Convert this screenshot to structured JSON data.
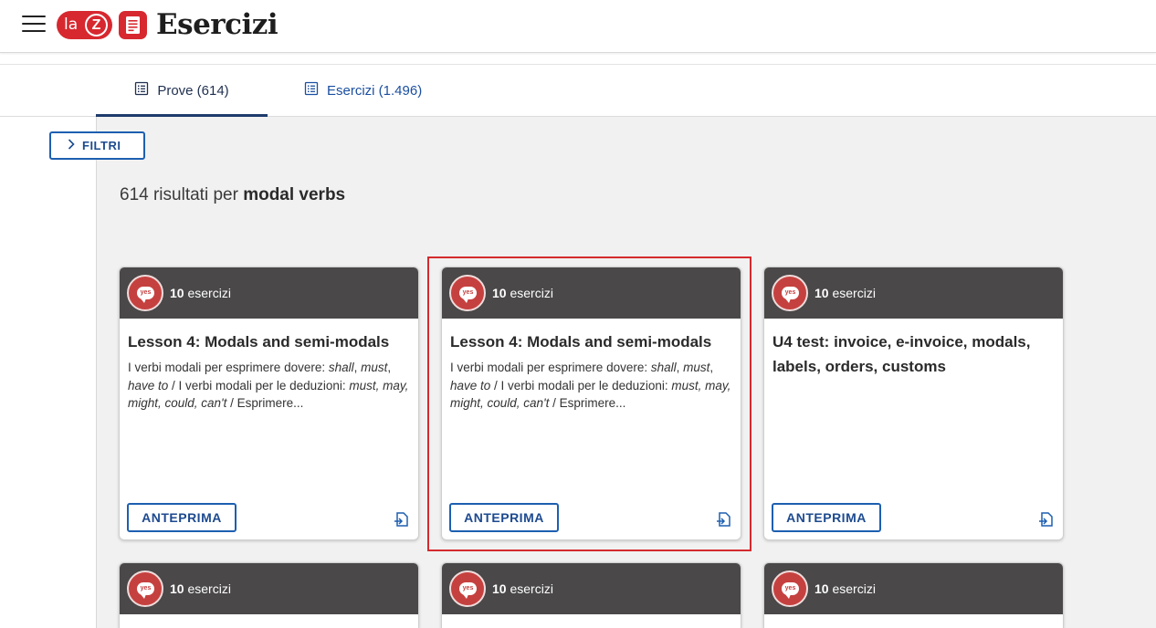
{
  "header": {
    "app_title": "Esercizi",
    "logo_la": "la",
    "logo_z": "Z"
  },
  "tabs": [
    {
      "label": "Prove (614)",
      "active": true
    },
    {
      "label": "Esercizi (1.496)",
      "active": false
    }
  ],
  "filters": {
    "label": "FILTRI"
  },
  "results": {
    "prefix": "614 risultati per",
    "query": "modal verbs"
  },
  "badge_text": "yes",
  "cards": [
    {
      "count_num": "10",
      "count_label": "esercizi",
      "title": "Lesson 4: Modals and semi-modals",
      "desc": {
        "p1": "I verbi modali per esprimere dovere: ",
        "p2": "shall",
        "p3": ", ",
        "p4": "must",
        "p5": ", ",
        "p6": "have to",
        "p7": " / I verbi modali per le deduzioni: ",
        "p8": "must, may, might, could, can't",
        "p9": " / Esprimere..."
      },
      "button": "ANTEPRIMA"
    },
    {
      "count_num": "10",
      "count_label": "esercizi",
      "title": "Lesson 4: Modals and semi-modals",
      "desc": {
        "p1": "I verbi modali per esprimere dovere: ",
        "p2": "shall",
        "p3": ", ",
        "p4": "must",
        "p5": ", ",
        "p6": "have to",
        "p7": " / I verbi modali per le deduzioni: ",
        "p8": "must, may, might, could, can't",
        "p9": " / Esprimere..."
      },
      "button": "ANTEPRIMA"
    },
    {
      "count_num": "10",
      "count_label": "esercizi",
      "title": "U4 test: invoice, e-invoice, modals, labels, orders, customs",
      "button": "ANTEPRIMA"
    },
    {
      "count_num": "10",
      "count_label": "esercizi"
    },
    {
      "count_num": "10",
      "count_label": "esercizi"
    },
    {
      "count_num": "10",
      "count_label": "esercizi"
    }
  ],
  "colors": {
    "brand_red": "#d7282f",
    "accent_blue": "#1d5fb0",
    "card_header": "#4a4848",
    "highlight": "#d42a2e"
  }
}
